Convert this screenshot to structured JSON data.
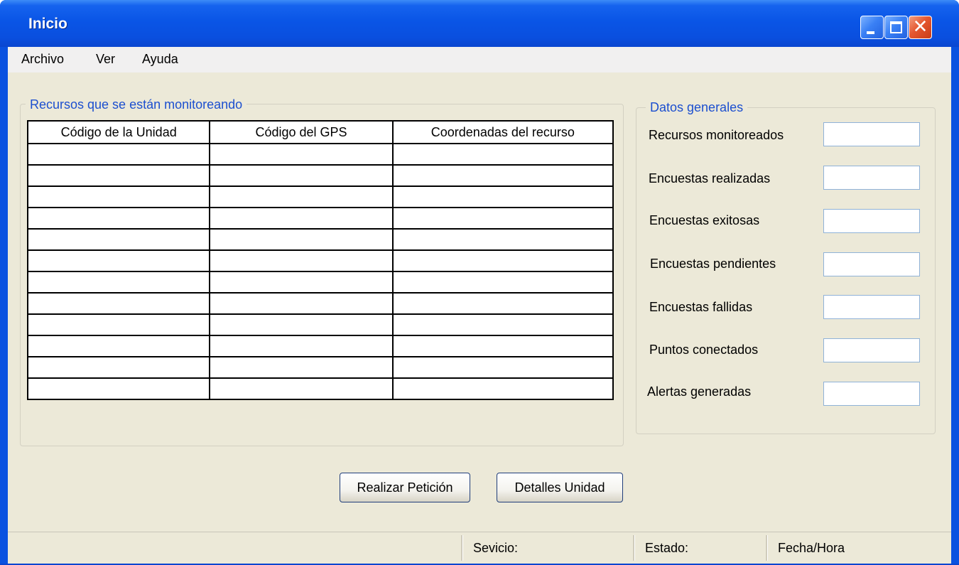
{
  "window": {
    "title": "Inicio",
    "controls": {
      "minimize": "minimize",
      "maximize": "maximize",
      "close": "close"
    }
  },
  "menu": [
    "Archivo",
    "Ver",
    "Ayuda"
  ],
  "resources_group": {
    "title": "Recursos que se están monitoreando",
    "columns": [
      "Código de la Unidad",
      "Código del GPS",
      "Coordenadas del recurso"
    ],
    "rows": [
      [
        "",
        "",
        ""
      ],
      [
        "",
        "",
        ""
      ],
      [
        "",
        "",
        ""
      ],
      [
        "",
        "",
        ""
      ],
      [
        "",
        "",
        ""
      ],
      [
        "",
        "",
        ""
      ],
      [
        "",
        "",
        ""
      ],
      [
        "",
        "",
        ""
      ],
      [
        "",
        "",
        ""
      ],
      [
        "",
        "",
        ""
      ],
      [
        "",
        "",
        ""
      ],
      [
        "",
        "",
        ""
      ]
    ]
  },
  "general_group": {
    "title": "Datos generales",
    "fields": [
      {
        "label": "Recursos monitoreados",
        "value": ""
      },
      {
        "label": "Encuestas realizadas",
        "value": ""
      },
      {
        "label": "Encuestas exitosas",
        "value": ""
      },
      {
        "label": "Encuestas pendientes",
        "value": ""
      },
      {
        "label": "Encuestas fallidas",
        "value": ""
      },
      {
        "label": "Puntos conectados",
        "value": ""
      },
      {
        "label": "Alertas generadas",
        "value": ""
      }
    ]
  },
  "buttons": {
    "request": "Realizar Petición",
    "details": "Detalles Unidad"
  },
  "statusbar": {
    "service": "Sevicio:",
    "state": "Estado:",
    "datetime": "Fecha/Hora"
  },
  "colors": {
    "titlebar": "#0a55e6",
    "client_bg": "#ece9d8",
    "group_title": "#1c4fcf",
    "close_button": "#e5572f"
  }
}
